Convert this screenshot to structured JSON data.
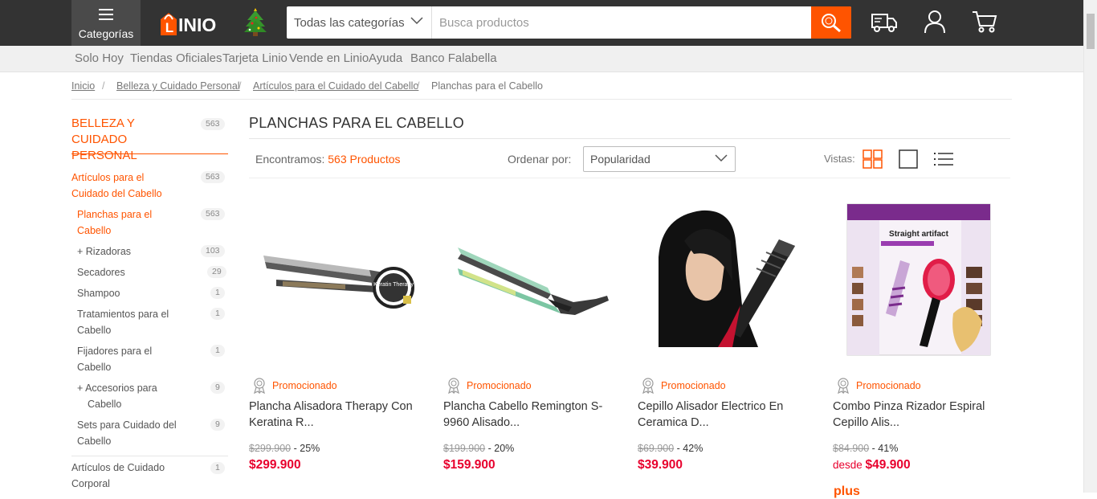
{
  "header": {
    "categories_label": "Categorías",
    "logo_text": "LINIO",
    "search_category": "Todas las categorías",
    "search_placeholder": "Busca productos",
    "search_value": ""
  },
  "subnav": [
    "Solo Hoy",
    "Tiendas Oficiales",
    "Tarjeta Linio",
    "Vende en Linio",
    "Ayuda",
    "Banco Falabella"
  ],
  "breadcrumb": {
    "links": [
      "Inicio",
      "Belleza y Cuidado Personal",
      "Artículos para el Cuidado del Cabello"
    ],
    "separator": "/",
    "current": "Planchas para el Cabello"
  },
  "sidebar": {
    "title_line1": "BELLEZA Y CUIDADO",
    "title_line2": "PERSONAL",
    "title_count": "563",
    "items": [
      {
        "line1": "Artículos para el",
        "line2": "Cuidado del Cabello",
        "count": "563"
      },
      {
        "line1": "Planchas para el",
        "line2": "Cabello",
        "count": "563"
      },
      {
        "line1": "+  Rizadoras",
        "line2": "",
        "count": "103"
      },
      {
        "line1": "Secadores",
        "line2": "",
        "count": "29"
      },
      {
        "line1": "Shampoo",
        "line2": "",
        "count": "1"
      },
      {
        "line1": "Tratamientos para el",
        "line2": "Cabello",
        "count": "1"
      },
      {
        "line1": "Fijadores para el",
        "line2": "Cabello",
        "count": "1"
      },
      {
        "line1": "+  Accesorios para",
        "line2": "Cabello",
        "count": "9"
      },
      {
        "line1": "Sets para Cuidado del",
        "line2": "Cabello",
        "count": "9"
      },
      {
        "line1": "Artículos de Cuidado",
        "line2": "Corporal",
        "count": "1"
      }
    ]
  },
  "main": {
    "title": "PLANCHAS PARA EL CABELLO",
    "found_prefix": "Encontramos:",
    "found_count": "563 Productos",
    "order_label": "Ordenar por:",
    "order_value": "Popularidad",
    "views_label": "Vistas:"
  },
  "products": [
    {
      "promo": "Promocionado",
      "name_line1": "Plancha Alisadora Therapy Con",
      "name_line2": "Keratina R...",
      "old_price": "$299.900",
      "discount": " - 25%",
      "price_prefix": "",
      "price": "$299.900",
      "image_text": "Keratin Therapy"
    },
    {
      "promo": "Promocionado",
      "name_line1": "Plancha Cabello Remington S-",
      "name_line2": "9960 Alisado...",
      "old_price": "$199.900",
      "discount": " - 20%",
      "price_prefix": "",
      "price": "$159.900"
    },
    {
      "promo": "Promocionado",
      "name_line1": "Cepillo Alisador Electrico En",
      "name_line2": "Ceramica D...",
      "old_price": "$69.900",
      "discount": " - 42%",
      "price_prefix": "",
      "price": "$39.900"
    },
    {
      "promo": "Promocionado",
      "name_line1": "Combo Pinza Rizador Espiral",
      "name_line2": "Cepillo Alis...",
      "old_price": "$84.900",
      "discount": " - 41%",
      "price_prefix": "desde ",
      "price": "$49.900",
      "image_text": "Straight artifact"
    }
  ],
  "plus_badge": "plus",
  "colors": {
    "accent": "#ff5400",
    "header_bg": "#333333",
    "price_red": "#e8002d"
  }
}
